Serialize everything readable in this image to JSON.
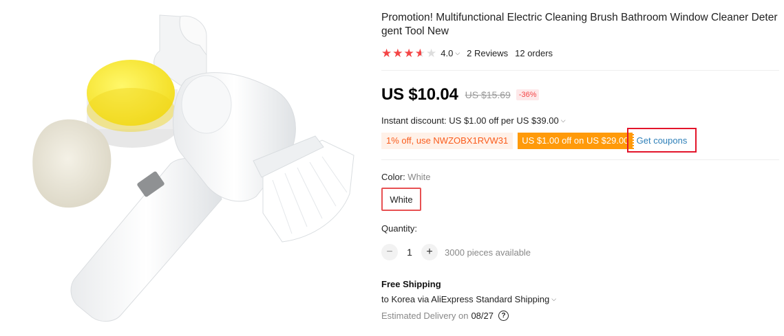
{
  "product": {
    "title": "Promotion! Multifunctional Electric Cleaning Brush Bathroom Window Cleaner Detergent Tool New",
    "rating": {
      "value": "4.0",
      "stars": 4,
      "max": 5,
      "reviews": "2 Reviews",
      "orders": "12 orders"
    },
    "price": {
      "current": "US $10.04",
      "original": "US $15.69",
      "discount": "-36%"
    },
    "instant_discount": "Instant discount: US $1.00 off per US $39.00",
    "coupons": {
      "code": "1% off, use NWZOBX1RVW31",
      "store": "US $1.00 off on US $29.00",
      "get_label": "Get coupons"
    },
    "color": {
      "label": "Color: ",
      "value": "White",
      "option": "White"
    },
    "quantity": {
      "label": "Quantity:",
      "value": "1",
      "available": "3000 pieces available",
      "minus": "−",
      "plus": "+"
    },
    "shipping": {
      "title": "Free Shipping",
      "via": "to Korea via AliExpress Standard Shipping",
      "estimated_label": "Estimated Delivery on",
      "estimated_date": "08/27"
    }
  },
  "icons": {
    "chevron": "chevron-down-icon",
    "help": "question-circle-icon",
    "star": "star-icon"
  },
  "colors": {
    "accent_red": "#f44546",
    "coupon_orange": "#ff9a0a",
    "link_blue": "#2d7fb8",
    "highlight_border": "#e3142a"
  }
}
